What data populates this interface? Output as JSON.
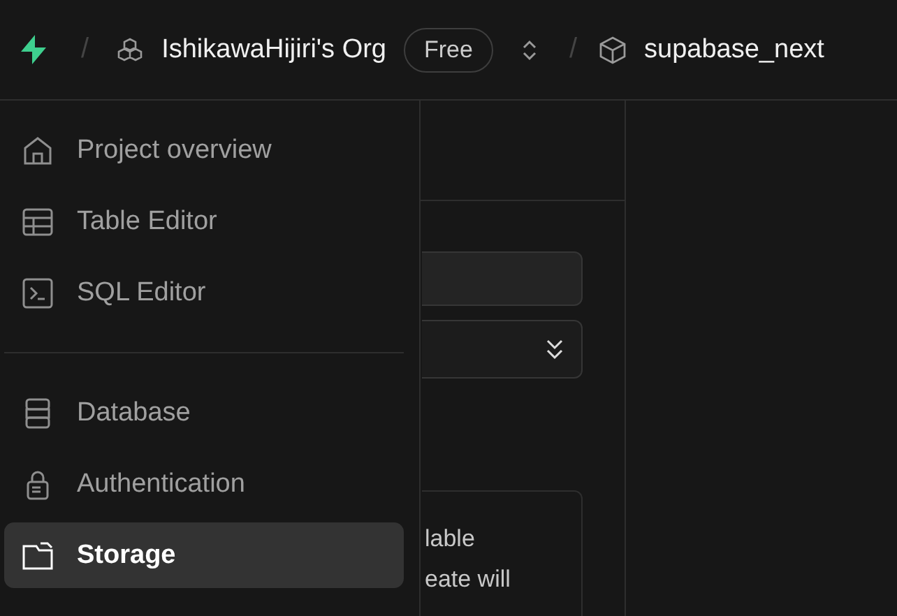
{
  "topbar": {
    "separators": [
      "/",
      "/"
    ],
    "org": {
      "name": "IshikawaHijiri's Org",
      "plan": "Free"
    },
    "project": {
      "name": "supabase_next"
    }
  },
  "sidebar": {
    "groups": [
      [
        {
          "label": "Project overview",
          "selected": false
        },
        {
          "label": "Table Editor",
          "selected": false
        },
        {
          "label": "SQL Editor",
          "selected": false
        }
      ],
      [
        {
          "label": "Database",
          "selected": false
        },
        {
          "label": "Authentication",
          "selected": false
        },
        {
          "label": "Storage",
          "selected": true
        }
      ]
    ]
  },
  "panel": {
    "card_lines": [
      "lable",
      "eate will"
    ]
  }
}
